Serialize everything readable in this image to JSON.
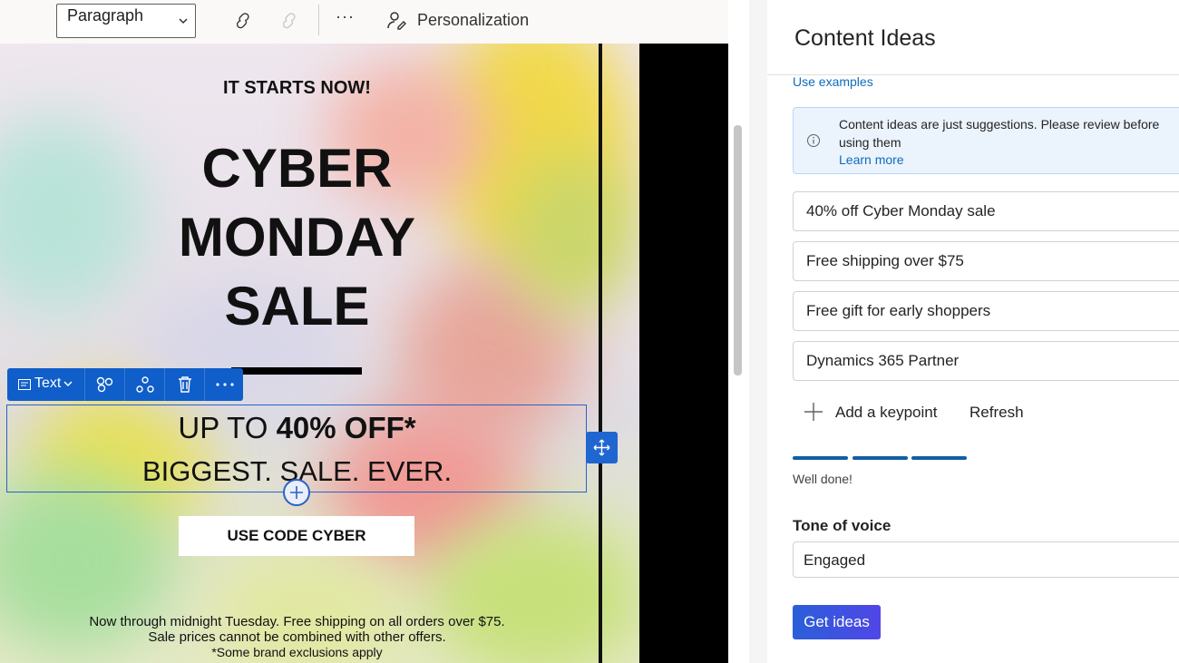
{
  "toolbar": {
    "paragraph_select": "Paragraph",
    "personalization_label": "Personalization",
    "more_label": "···"
  },
  "email": {
    "preheader": "IT STARTS NOW!",
    "title_lines": [
      "CYBER",
      "MONDAY",
      "SALE"
    ],
    "block_toolbar_label": "Text",
    "offer_prefix": "UP TO ",
    "offer_bold": "40% OFF*",
    "tagline": "BIGGEST. SALE. EVER.",
    "code_button": "USE CODE CYBER",
    "fine_print": [
      "Now through midnight Tuesday. Free shipping on all orders over $75.",
      "Sale prices cannot be combined with other offers.",
      "*Some brand exclusions apply"
    ]
  },
  "pane": {
    "title": "Content Ideas",
    "use_examples": "Use examples",
    "info_message": "Content ideas are just suggestions. Please review before using them",
    "learn_more": "Learn more",
    "keypoints": [
      "40% off Cyber Monday sale",
      "Free shipping over $75",
      "Free gift for early shoppers",
      "Dynamics 365 Partner"
    ],
    "add_keypoint": "Add a keypoint",
    "refresh": "Refresh",
    "progress_steps_complete": 3,
    "progress_steps_total": 3,
    "progress_message": "Well done!",
    "tone_label": "Tone of voice",
    "tone_value": "Engaged",
    "get_ideas": "Get ideas"
  },
  "colors": {
    "accent": "#0f6cbd",
    "block_toolbar": "#0f5ec9",
    "button_gradient_start": "#2b5fd9",
    "button_gradient_end": "#5046e6"
  }
}
